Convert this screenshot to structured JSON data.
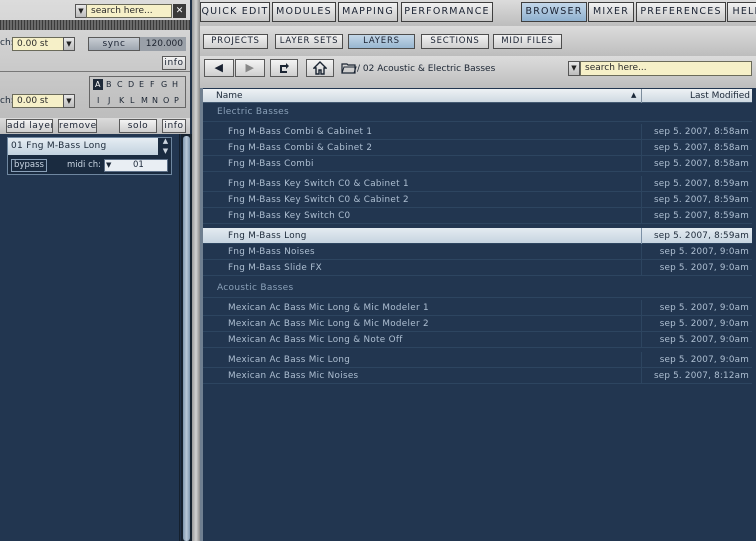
{
  "top_left": {
    "search_placeholder": "search here...",
    "close_glyph": "✕",
    "row1_label": "ch:",
    "tune_value": "0.00 st",
    "sync_label": "sync",
    "tempo_value": "120.000",
    "info1_label": "info",
    "row2_label": "ch:",
    "tune2_value": "0.00 st",
    "letters_row1": [
      "A",
      "B",
      "C",
      "D",
      "E",
      "F",
      "G",
      "H"
    ],
    "letters_row2": [
      "I",
      "J",
      "K",
      "L",
      "M",
      "N",
      "O",
      "P"
    ],
    "add_layer": "add layer",
    "remove": "remove",
    "solo": "solo",
    "info2_label": "info"
  },
  "layer": {
    "name": "01  Fng M-Bass Long",
    "bypass": "bypass",
    "midi_label": "midi ch:",
    "midi_value": "01"
  },
  "tabs": [
    "QUICK EDIT",
    "MODULES",
    "MAPPING",
    "PERFORMANCE",
    "BROWSER",
    "MIXER",
    "PREFERENCES",
    "HELP"
  ],
  "subtabs": [
    "PROJECTS",
    "LAYER SETS",
    "LAYERS",
    "SECTIONS",
    "MIDI FILES"
  ],
  "path": "/ 02 Acoustic & Electric Basses",
  "browser_search_placeholder": "search here...",
  "columns": {
    "name": "Name",
    "modified": "Last Modified"
  },
  "groups": [
    {
      "title": "Electric Basses",
      "rows": [
        {
          "name": "Fng M-Bass Combi & Cabinet 1",
          "date": "sep 5. 2007, 8:58am"
        },
        {
          "name": "Fng M-Bass Combi & Cabinet 2",
          "date": "sep 5. 2007, 8:58am"
        },
        {
          "name": "Fng M-Bass Combi",
          "date": "sep 5. 2007, 8:58am"
        },
        {
          "name": "Fng M-Bass Key Switch C0 & Cabinet 1",
          "date": "sep 5. 2007, 8:59am"
        },
        {
          "name": "Fng M-Bass Key Switch C0 & Cabinet 2",
          "date": "sep 5. 2007, 8:59am"
        },
        {
          "name": "Fng M-Bass Key Switch C0",
          "date": "sep 5. 2007, 8:59am"
        },
        {
          "name": "Fng M-Bass Long",
          "date": "sep 5. 2007, 8:59am",
          "selected": true
        },
        {
          "name": "Fng M-Bass Noises",
          "date": "sep 5. 2007, 9:0am"
        },
        {
          "name": "Fng M-Bass Slide FX",
          "date": "sep 5. 2007, 9:0am"
        }
      ]
    },
    {
      "title": "Acoustic Basses",
      "rows": [
        {
          "name": "Mexican Ac Bass Mic Long & Mic Modeler 1",
          "date": "sep 5. 2007, 9:0am"
        },
        {
          "name": "Mexican Ac Bass Mic Long & Mic Modeler 2",
          "date": "sep 5. 2007, 9:0am"
        },
        {
          "name": "Mexican Ac Bass Mic Long & Note Off",
          "date": "sep 5. 2007, 9:0am"
        },
        {
          "name": "Mexican Ac Bass Mic Long",
          "date": "sep 5. 2007, 9:0am"
        },
        {
          "name": "Mexican Ac Bass Mic Noises",
          "date": "sep 5. 2007, 8:12am"
        }
      ]
    }
  ],
  "icons": {
    "back": "◀",
    "forward": "▶",
    "refresh": "refresh-icon",
    "home": "home-icon",
    "folder": "folder-icon",
    "dropdown": "▼",
    "sort": "▲"
  }
}
